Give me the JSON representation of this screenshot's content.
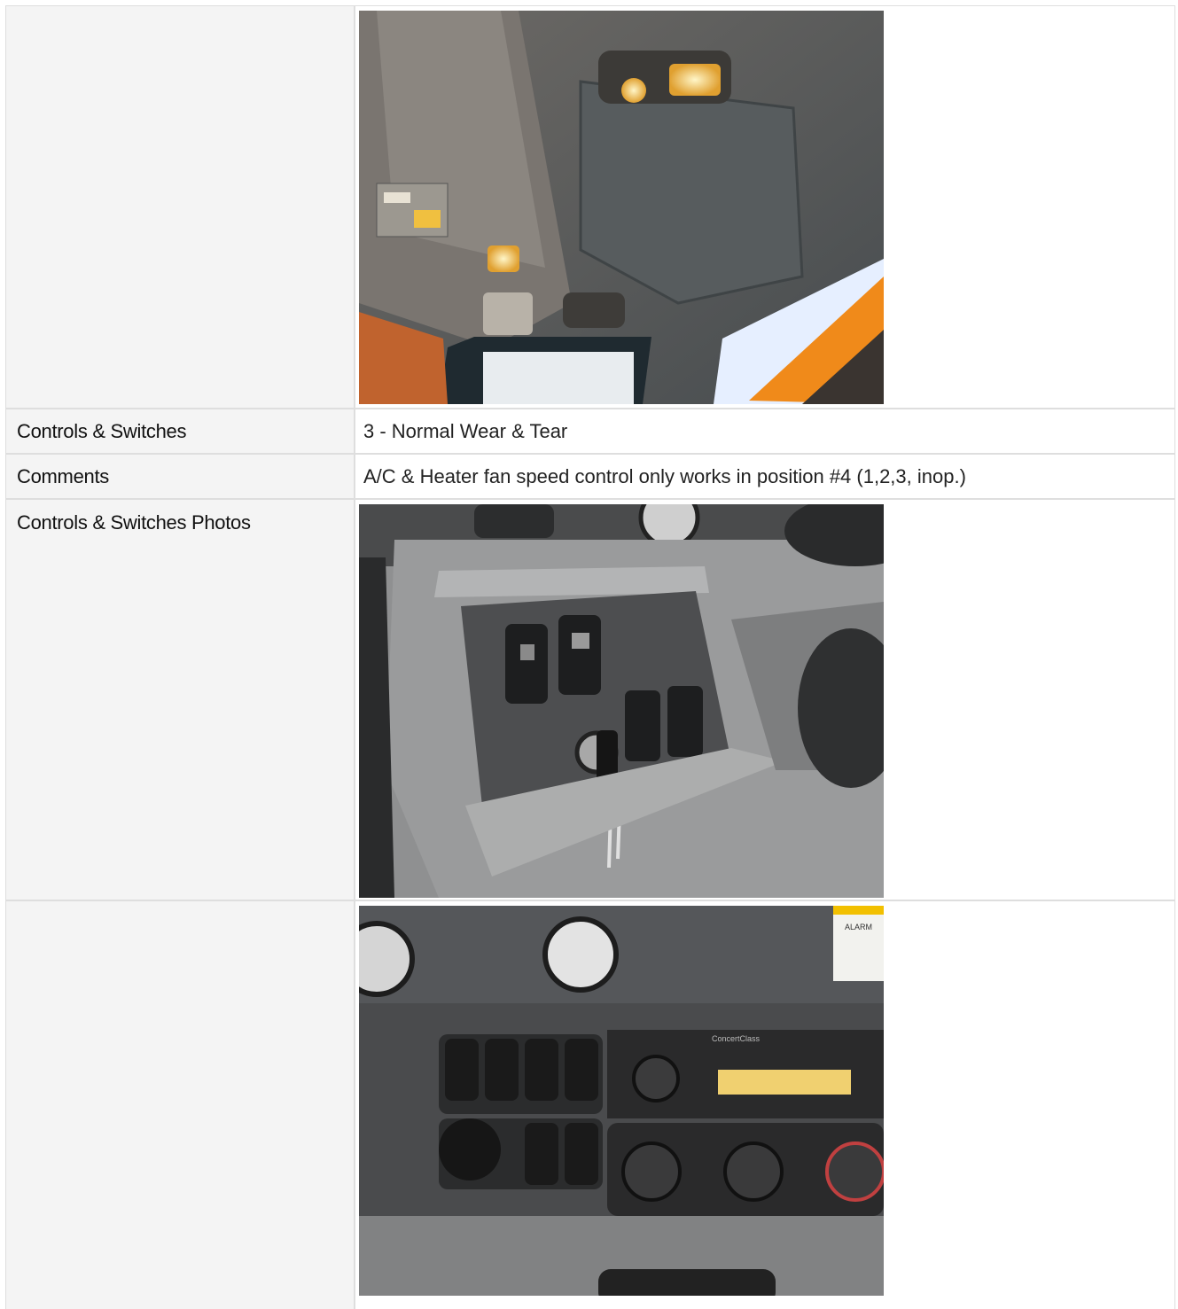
{
  "rows": [
    {
      "label": "",
      "photo_icon": "photo-cab-headliner"
    },
    {
      "label": "Controls & Switches",
      "value": "3 - Normal Wear & Tear"
    },
    {
      "label": "Comments",
      "value": "A/C & Heater fan speed control only works in position #4 (1,2,3, inop.)"
    },
    {
      "label": "Controls & Switches Photos",
      "photo_icon": "photo-dash-switch-panel"
    },
    {
      "label": "",
      "photo_icon": "photo-dash-center-console"
    }
  ],
  "photo_text": {
    "radio_brand": "ConcertClass",
    "warning_label": "ALARM"
  }
}
